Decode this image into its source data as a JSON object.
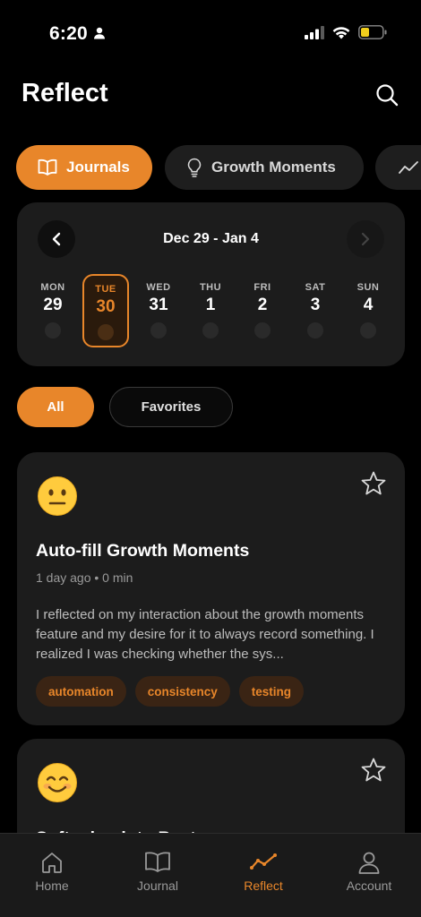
{
  "status_bar": {
    "time": "6:20",
    "person_icon": "person-icon",
    "signal_icon": "cellular-signal-icon",
    "wifi_icon": "wifi-icon",
    "battery_icon": "battery-low-icon"
  },
  "header": {
    "title": "Reflect",
    "search_icon": "search-icon"
  },
  "segments": [
    {
      "label": "Journals",
      "icon": "book-icon",
      "selected": true
    },
    {
      "label": "Growth Moments",
      "icon": "lightbulb-icon",
      "selected": false
    },
    {
      "label": "",
      "icon": "trend-line-icon",
      "selected": false
    }
  ],
  "week": {
    "range": "Dec 29 - Jan 4",
    "days": [
      {
        "name": "MON",
        "num": "29",
        "selected": false
      },
      {
        "name": "TUE",
        "num": "30",
        "selected": true
      },
      {
        "name": "WED",
        "num": "31",
        "selected": false
      },
      {
        "name": "THU",
        "num": "1",
        "selected": false
      },
      {
        "name": "FRI",
        "num": "2",
        "selected": false
      },
      {
        "name": "SAT",
        "num": "3",
        "selected": false
      },
      {
        "name": "SUN",
        "num": "4",
        "selected": false
      }
    ]
  },
  "filters": {
    "all_label": "All",
    "favorites_label": "Favorites",
    "selected": "All"
  },
  "entries": [
    {
      "mood_icon": "neutral-face-emoji",
      "title": "Auto-fill Growth Moments",
      "meta": "1 day ago • 0 min",
      "excerpt": "I reflected on my interaction about the growth moments feature and my desire for it to always record something. I realized I was checking whether the sys...",
      "tags": [
        "automation",
        "consistency",
        "testing"
      ],
      "favorite": false
    },
    {
      "mood_icon": "smiling-face-emoji",
      "title": "Softening into Best",
      "favorite": false
    }
  ],
  "tab_bar": {
    "tabs": [
      {
        "label": "Home",
        "icon": "home-icon",
        "active": false
      },
      {
        "label": "Journal",
        "icon": "book-icon",
        "active": false
      },
      {
        "label": "Reflect",
        "icon": "trend-line-icon",
        "active": true
      },
      {
        "label": "Account",
        "icon": "person-icon",
        "active": false
      }
    ]
  },
  "colors": {
    "accent": "#E8862A",
    "background": "#000000",
    "card": "#1C1C1C",
    "tag_bg": "#3A2414"
  }
}
